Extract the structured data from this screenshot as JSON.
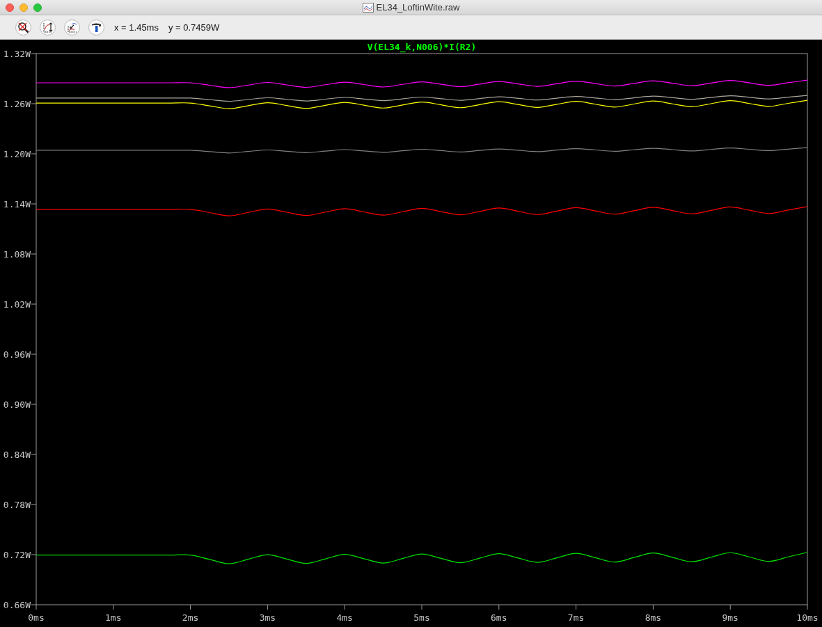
{
  "window": {
    "title": "EL34_LoftinWite.raw"
  },
  "toolbar": {
    "cursor_x": "x = 1.45ms",
    "cursor_y": "y = 0.7459W"
  },
  "plot": {
    "chart_data": {
      "type": "line",
      "title": "V(EL34_k,N006)*I(R2)",
      "x": [
        0,
        1,
        1.75,
        2,
        2.25,
        2.5,
        2.75,
        3,
        3.25,
        3.5,
        3.75,
        4,
        4.25,
        4.5,
        4.75,
        5,
        5.25,
        5.5,
        5.75,
        6,
        6.25,
        6.5,
        6.75,
        7,
        7.25,
        7.5,
        7.75,
        8,
        8.25,
        8.5,
        8.75,
        9,
        9.25,
        9.5,
        9.75,
        10
      ],
      "series": [
        {
          "color": "#ff00ff",
          "values": [
            1.285,
            1.285,
            1.285,
            1.285,
            1.2821,
            1.2792,
            1.2823,
            1.2854,
            1.2825,
            1.2796,
            1.2827,
            1.2858,
            1.2829,
            1.28,
            1.2831,
            1.2862,
            1.2833,
            1.2804,
            1.2835,
            1.2866,
            1.2837,
            1.2808,
            1.2839,
            1.287,
            1.2841,
            1.2812,
            1.2843,
            1.2874,
            1.2845,
            1.2816,
            1.2847,
            1.2878,
            1.2849,
            1.282,
            1.2851,
            1.2882
          ]
        },
        {
          "color": "#aaa79d",
          "values": [
            1.2667,
            1.2667,
            1.2667,
            1.2667,
            1.2648,
            1.2629,
            1.265,
            1.2671,
            1.2652,
            1.2633,
            1.2654,
            1.2675,
            1.2656,
            1.2637,
            1.2658,
            1.2679,
            1.266,
            1.2641,
            1.2662,
            1.2683,
            1.2664,
            1.2645,
            1.2666,
            1.2687,
            1.2668,
            1.2649,
            1.267,
            1.2691,
            1.2672,
            1.2653,
            1.2674,
            1.2695,
            1.2676,
            1.2657,
            1.2678,
            1.2699
          ]
        },
        {
          "color": "#ffff00",
          "values": [
            1.2608,
            1.2608,
            1.2608,
            1.2608,
            1.2574,
            1.254,
            1.2576,
            1.2612,
            1.2578,
            1.2544,
            1.258,
            1.2616,
            1.2582,
            1.2548,
            1.2584,
            1.262,
            1.2586,
            1.2552,
            1.2588,
            1.2624,
            1.259,
            1.2556,
            1.2592,
            1.2628,
            1.2594,
            1.256,
            1.2596,
            1.2632,
            1.2598,
            1.2564,
            1.26,
            1.2636,
            1.2602,
            1.2568,
            1.2604,
            1.264
          ]
        },
        {
          "color": "#808080",
          "values": [
            1.2042,
            1.2042,
            1.2042,
            1.2042,
            1.2026,
            1.201,
            1.2028,
            1.2046,
            1.203,
            1.2014,
            1.2032,
            1.205,
            1.2034,
            1.2018,
            1.2036,
            1.2054,
            1.2038,
            1.2022,
            1.204,
            1.2058,
            1.2042,
            1.2026,
            1.2044,
            1.2062,
            1.2046,
            1.203,
            1.2048,
            1.2066,
            1.205,
            1.2034,
            1.2052,
            1.207,
            1.2054,
            1.2038,
            1.2056,
            1.2074
          ]
        },
        {
          "color": "#ff0000",
          "values": [
            1.1335,
            1.1335,
            1.1335,
            1.1335,
            1.1296,
            1.1257,
            1.1298,
            1.1339,
            1.13,
            1.1261,
            1.1302,
            1.1343,
            1.1304,
            1.1265,
            1.1306,
            1.1347,
            1.1308,
            1.1269,
            1.131,
            1.1351,
            1.1312,
            1.1273,
            1.1314,
            1.1355,
            1.1316,
            1.1277,
            1.1318,
            1.1359,
            1.132,
            1.1281,
            1.1322,
            1.1363,
            1.1324,
            1.1285,
            1.1326,
            1.1367
          ]
        },
        {
          "color": "#00e000",
          "values": [
            0.7195,
            0.7195,
            0.7195,
            0.7195,
            0.7143,
            0.7091,
            0.7145,
            0.7199,
            0.7147,
            0.7095,
            0.7149,
            0.7203,
            0.7151,
            0.7099,
            0.7153,
            0.7207,
            0.7155,
            0.7103,
            0.7157,
            0.7211,
            0.7159,
            0.7107,
            0.7161,
            0.7215,
            0.7163,
            0.7111,
            0.7165,
            0.7219,
            0.7167,
            0.7115,
            0.7169,
            0.7223,
            0.7171,
            0.7119,
            0.7173,
            0.7227
          ]
        }
      ],
      "xlim": [
        0,
        10
      ],
      "ylim": [
        0.66,
        1.32
      ],
      "xticks": [
        {
          "value": 0,
          "label": "0ms"
        },
        {
          "value": 1,
          "label": "1ms"
        },
        {
          "value": 2,
          "label": "2ms"
        },
        {
          "value": 3,
          "label": "3ms"
        },
        {
          "value": 4,
          "label": "4ms"
        },
        {
          "value": 5,
          "label": "5ms"
        },
        {
          "value": 6,
          "label": "6ms"
        },
        {
          "value": 7,
          "label": "7ms"
        },
        {
          "value": 8,
          "label": "8ms"
        },
        {
          "value": 9,
          "label": "9ms"
        },
        {
          "value": 10,
          "label": "10ms"
        }
      ],
      "yticks": [
        {
          "value": 0.66,
          "label": "0.66W"
        },
        {
          "value": 0.72,
          "label": "0.72W"
        },
        {
          "value": 0.78,
          "label": "0.78W"
        },
        {
          "value": 0.84,
          "label": "0.84W"
        },
        {
          "value": 0.9,
          "label": "0.90W"
        },
        {
          "value": 0.96,
          "label": "0.96W"
        },
        {
          "value": 1.02,
          "label": "1.02W"
        },
        {
          "value": 1.08,
          "label": "1.08W"
        },
        {
          "value": 1.14,
          "label": "1.14W"
        },
        {
          "value": 1.2,
          "label": "1.20W"
        },
        {
          "value": 1.26,
          "label": "1.26W"
        },
        {
          "value": 1.32,
          "label": "1.32W"
        }
      ]
    }
  }
}
